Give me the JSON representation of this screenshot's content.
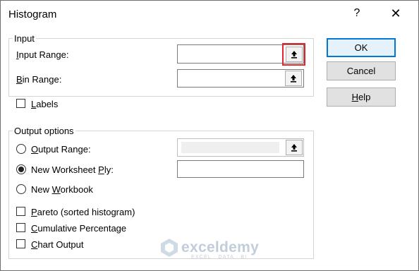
{
  "window": {
    "title": "Histogram",
    "help_glyph": "?",
    "close_glyph": "✕"
  },
  "input_group": {
    "legend": "Input",
    "input_range": {
      "label_prefix": "",
      "label_accel": "I",
      "label_rest": "nput Range:",
      "value": ""
    },
    "bin_range": {
      "label_prefix": "",
      "label_accel": "B",
      "label_rest": "in Range:",
      "value": ""
    }
  },
  "labels_checkbox": {
    "label_prefix": "",
    "label_accel": "L",
    "label_rest": "abels",
    "checked": false
  },
  "output_group": {
    "legend": "Output options",
    "output_range": {
      "label_prefix": "",
      "label_accel": "O",
      "label_rest": "utput Range:",
      "selected": false,
      "value": ""
    },
    "new_worksheet_ply": {
      "label_prefix": "New Worksheet ",
      "label_accel": "P",
      "label_rest": "ly:",
      "selected": true,
      "value": ""
    },
    "new_workbook": {
      "label_prefix": "New ",
      "label_accel": "W",
      "label_rest": "orkbook",
      "selected": false
    }
  },
  "options": {
    "pareto": {
      "label_prefix": "",
      "label_accel": "P",
      "label_rest": "areto (sorted histogram)",
      "checked": false
    },
    "cumulative": {
      "label_prefix": "",
      "label_accel": "C",
      "label_rest": "umulative Percentage",
      "checked": false
    },
    "chart_output": {
      "label_prefix": "",
      "label_accel": "C",
      "label_rest": "hart Output",
      "checked": false
    }
  },
  "buttons": {
    "ok": "OK",
    "cancel": "Cancel",
    "help_prefix": "",
    "help_accel": "H",
    "help_rest": "elp"
  },
  "icons": {
    "collapse_dialog": "collapse-dialog-icon"
  },
  "colors": {
    "highlight": "#e3262b",
    "default_button_border": "#0078d7"
  },
  "watermark": {
    "brand": "exceldemy",
    "tagline": "EXCEL · DATA · BI"
  }
}
